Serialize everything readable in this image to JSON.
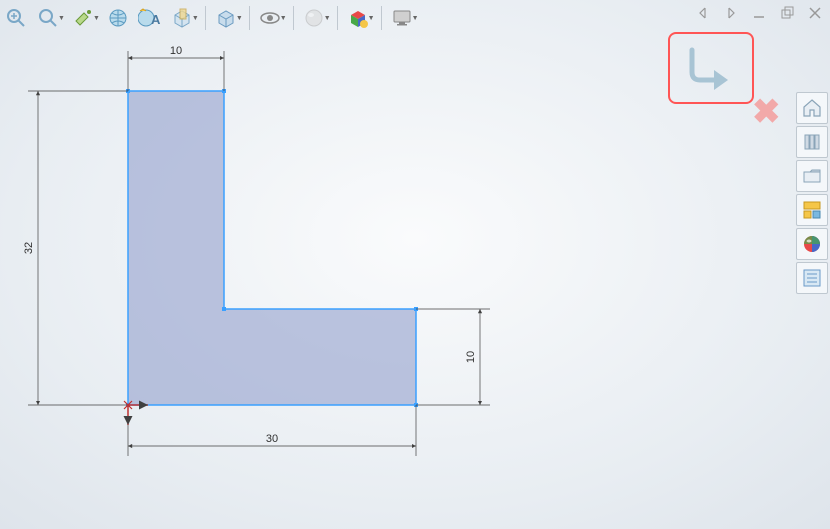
{
  "toolbar": {
    "items": [
      {
        "name": "zoom-fit-icon"
      },
      {
        "name": "zoom-icon"
      },
      {
        "name": "paint-icon"
      },
      {
        "name": "globe-icon"
      },
      {
        "name": "font-icon"
      },
      {
        "name": "section-icon"
      },
      {
        "name": "cube-icon"
      },
      {
        "name": "eye-icon"
      },
      {
        "name": "sphere-icon"
      },
      {
        "name": "color-cube-icon"
      },
      {
        "name": "monitor-icon"
      }
    ]
  },
  "window_controls": {
    "prev": "◁",
    "next": "▷",
    "min": "—",
    "restore": "❐",
    "close": "✕"
  },
  "sidebar": {
    "items": [
      {
        "name": "home-icon"
      },
      {
        "name": "library-icon"
      },
      {
        "name": "folder-icon"
      },
      {
        "name": "layout-icon"
      },
      {
        "name": "color-ball-icon"
      },
      {
        "name": "list-icon"
      }
    ]
  },
  "chart_data": {
    "type": "diagram",
    "shape": "L-profile",
    "units": "mm",
    "dimensions": {
      "total_width": 30,
      "total_height": 32,
      "top_arm_width": 10,
      "right_arm_height": 10
    },
    "dim_labels": {
      "top": "10",
      "left": "32",
      "bottom": "30",
      "right": "10"
    }
  },
  "highlight": {
    "name": "return-icon"
  }
}
